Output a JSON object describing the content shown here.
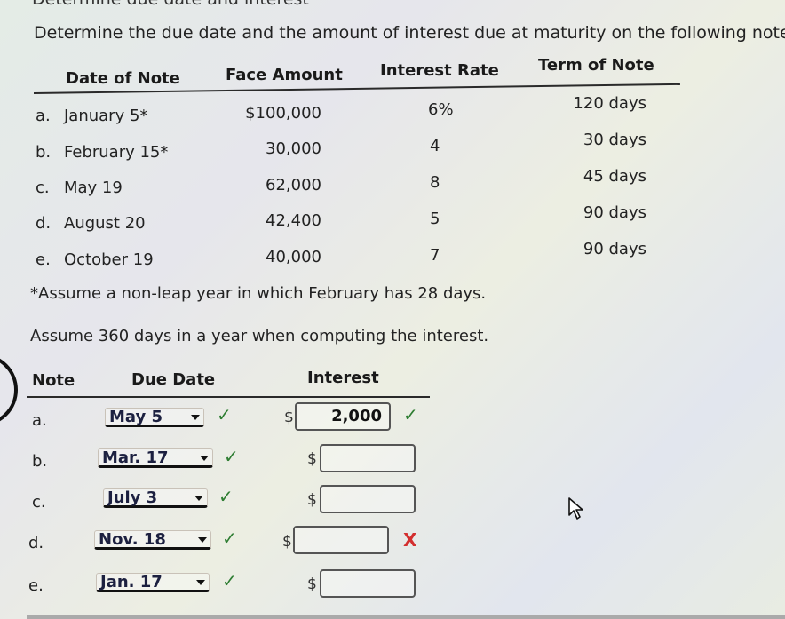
{
  "cut_off_title": "Determine due date and interest",
  "instruction": "Determine the due date and the amount of interest due at maturity on the following notes:",
  "notes_table": {
    "headers": [
      "Date of Note",
      "Face Amount",
      "Interest Rate",
      "Term of Note"
    ],
    "rows": [
      {
        "label": "a.",
        "date": "January 5*",
        "face": "$100,000",
        "rate": "6%",
        "term": "120 days"
      },
      {
        "label": "b.",
        "date": "February 15*",
        "face": "30,000",
        "rate": "4",
        "term": "30 days"
      },
      {
        "label": "c.",
        "date": "May 19",
        "face": "62,000",
        "rate": "8",
        "term": "45 days"
      },
      {
        "label": "d.",
        "date": "August 20",
        "face": "42,400",
        "rate": "5",
        "term": "90 days"
      },
      {
        "label": "e.",
        "date": "October 19",
        "face": "40,000",
        "rate": "7",
        "term": "90 days"
      }
    ]
  },
  "footnote": "*Assume a non-leap year in which February has 28 days.",
  "assumption": "Assume 360 days in a year when computing the interest.",
  "answer_table": {
    "headers": [
      "Note",
      "Due Date",
      "Interest"
    ],
    "currency_symbol": "$",
    "rows": [
      {
        "label": "a.",
        "due_date": "May 5",
        "due_status": "correct",
        "interest": "2,000",
        "interest_status": "correct"
      },
      {
        "label": "b.",
        "due_date": "Mar. 17",
        "due_status": "correct",
        "interest": "",
        "interest_status": "none"
      },
      {
        "label": "c.",
        "due_date": "July 3",
        "due_status": "correct",
        "interest": "",
        "interest_status": "none"
      },
      {
        "label": "d.",
        "due_date": "Nov. 18",
        "due_status": "correct",
        "interest": "",
        "interest_status": "incorrect"
      },
      {
        "label": "e.",
        "due_date": "Jan. 17",
        "due_status": "correct",
        "interest": "",
        "interest_status": "none"
      }
    ]
  },
  "icons": {
    "check": "✓",
    "cross": "X"
  },
  "colors": {
    "correct": "#2e7d32",
    "incorrect": "#d32f2f"
  }
}
